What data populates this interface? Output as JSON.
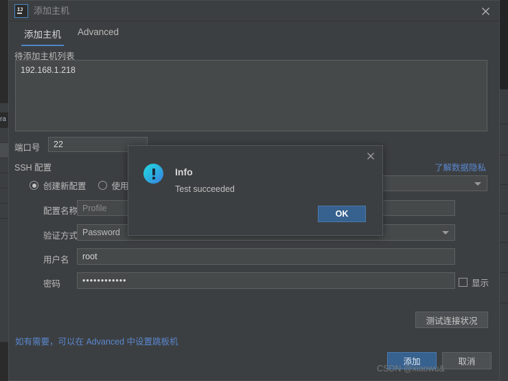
{
  "window": {
    "title": "添加主机",
    "app_icon": "intellij-idea-logo",
    "close_icon": "close-icon"
  },
  "tabs": [
    {
      "label": "添加主机",
      "active": true
    },
    {
      "label": "Advanced",
      "active": false
    }
  ],
  "form": {
    "host_list_label": "待添加主机列表",
    "host_list_value": "192.168.1.218",
    "port_label": "端口号",
    "port_value": "22",
    "ssh_section_label": "SSH 配置",
    "privacy_link": "了解数据隐私",
    "radio_new_config": "创建新配置",
    "radio_existing_config": "使用已有配置",
    "profile_label": "配置名称",
    "profile_value": "Profile",
    "auth_label": "验证方式",
    "auth_value": "Password",
    "username_label": "用户名",
    "username_value": "root",
    "password_label": "密码",
    "password_value": "••••••••••••",
    "show_password_label": "显示",
    "test_connection_label": "测试连接状况",
    "hint_link": "如有需要，可以在 Advanced 中设置跳板机"
  },
  "footer": {
    "add_label": "添加",
    "cancel_label": "取消"
  },
  "info_dialog": {
    "title": "Info",
    "message": "Test succeeded",
    "ok_label": "OK",
    "close_icon": "close-icon",
    "icon": "info-exclamation-icon"
  },
  "watermark": "CSDN @xiaowu&",
  "colors": {
    "accent": "#4a88c7",
    "primary_button": "#37618e",
    "link": "#5a87d0",
    "background": "#3c3f41",
    "field": "#45494a"
  },
  "background_ide": {
    "left_fragment": "ra"
  }
}
